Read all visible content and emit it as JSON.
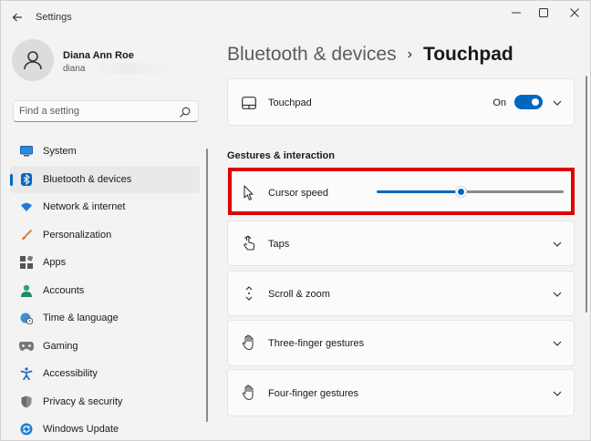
{
  "window": {
    "title": "Settings",
    "controls": [
      "minimize",
      "maximize",
      "close"
    ]
  },
  "profile": {
    "name": "Diana Ann Roe",
    "email": "diana"
  },
  "search": {
    "placeholder": "Find a setting"
  },
  "sidebar": {
    "items": [
      {
        "label": "System",
        "icon": "monitor-icon",
        "active": false
      },
      {
        "label": "Bluetooth & devices",
        "icon": "bluetooth-icon",
        "active": true
      },
      {
        "label": "Network & internet",
        "icon": "wifi-icon",
        "active": false
      },
      {
        "label": "Personalization",
        "icon": "brush-icon",
        "active": false
      },
      {
        "label": "Apps",
        "icon": "apps-icon",
        "active": false
      },
      {
        "label": "Accounts",
        "icon": "person-icon",
        "active": false
      },
      {
        "label": "Time & language",
        "icon": "globe-clock-icon",
        "active": false
      },
      {
        "label": "Gaming",
        "icon": "gamepad-icon",
        "active": false
      },
      {
        "label": "Accessibility",
        "icon": "accessibility-icon",
        "active": false
      },
      {
        "label": "Privacy & security",
        "icon": "shield-icon",
        "active": false
      },
      {
        "label": "Windows Update",
        "icon": "update-icon",
        "active": false
      }
    ]
  },
  "breadcrumb": {
    "parent": "Bluetooth & devices",
    "separator": "›",
    "current": "Touchpad"
  },
  "touchpad_card": {
    "label": "Touchpad",
    "toggle_state": "On",
    "toggle_on": true
  },
  "gestures": {
    "section_title": "Gestures & interaction",
    "cursor_speed": {
      "label": "Cursor speed",
      "value_fraction": 0.45
    },
    "cards": [
      {
        "label": "Taps",
        "icon": "tap-icon"
      },
      {
        "label": "Scroll & zoom",
        "icon": "scroll-icon"
      },
      {
        "label": "Three-finger gestures",
        "icon": "hand-icon"
      },
      {
        "label": "Four-finger gestures",
        "icon": "hand-icon"
      }
    ]
  },
  "colors": {
    "accent": "#0067c0",
    "highlight": "#e00000",
    "background": "#f3f3f3",
    "card": "#fbfbfb"
  }
}
